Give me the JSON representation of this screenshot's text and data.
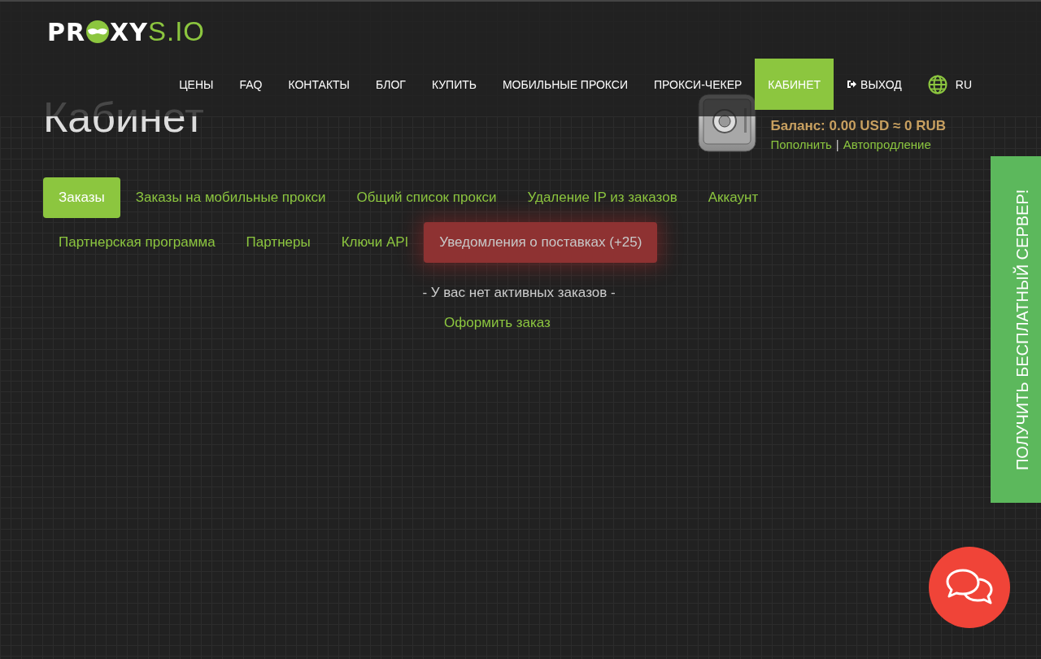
{
  "logo": {
    "before": "PR",
    "middle": "XY",
    "after": "S.IO"
  },
  "nav": [
    {
      "label": "ЦЕНЫ",
      "kind": "link",
      "selected": false
    },
    {
      "label": "FAQ",
      "kind": "link",
      "selected": false
    },
    {
      "label": "КОНТАКТЫ",
      "kind": "link",
      "selected": false
    },
    {
      "label": "БЛОГ",
      "kind": "link",
      "selected": false
    },
    {
      "label": "КУПИТЬ",
      "kind": "link",
      "selected": false
    },
    {
      "label": "МОБИЛЬНЫЕ ПРОКСИ",
      "kind": "link",
      "selected": false
    },
    {
      "label": "ПРОКСИ-ЧЕКЕР",
      "kind": "link",
      "selected": false
    },
    {
      "label": "КАБИНЕТ",
      "kind": "link",
      "selected": true
    },
    {
      "label": "ВЫХОД",
      "kind": "logout",
      "selected": false
    },
    {
      "label": "RU",
      "kind": "language",
      "selected": false
    }
  ],
  "page_title": "Кабинет",
  "balance": {
    "text": "Баланс: 0.00 USD ≈ 0 RUB",
    "links": [
      "Пополнить",
      "Автопродление"
    ],
    "separator": "|"
  },
  "tab_rows": [
    [
      {
        "label": "Заказы",
        "kind": "normal",
        "selected": true
      },
      {
        "label": "Заказы на мобильные прокси",
        "kind": "normal",
        "selected": false
      },
      {
        "label": "Общий список прокси",
        "kind": "normal",
        "selected": false
      },
      {
        "label": "Удаление IP из заказов",
        "kind": "normal",
        "selected": false
      },
      {
        "label": "Аккаунт",
        "kind": "normal",
        "selected": false
      }
    ],
    [
      {
        "label": "Партнерская программа",
        "kind": "normal",
        "selected": false
      },
      {
        "label": "Партнеры",
        "kind": "normal",
        "selected": false
      },
      {
        "label": "Ключи API",
        "kind": "normal",
        "selected": false
      },
      {
        "label": "Уведомления о поставках (+25)",
        "kind": "alert",
        "selected": false
      }
    ]
  ],
  "empty_message": "- У вас нет активных заказов -",
  "order_link": "Оформить заказ",
  "side_tab": "ПОЛУЧИТЬ БЕСПЛАТНЫЙ СЕРВЕР!"
}
